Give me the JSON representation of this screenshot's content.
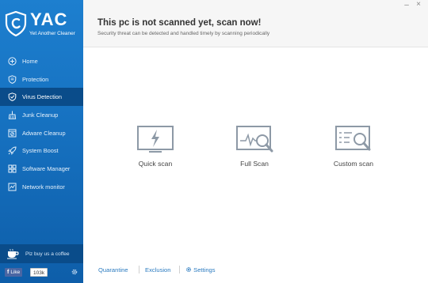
{
  "app": {
    "logo_title": "YAC",
    "logo_subtitle": "Yet Another Cleaner"
  },
  "sidebar": {
    "items": [
      {
        "label": "Home",
        "icon": "home-icon"
      },
      {
        "label": "Protection",
        "icon": "shield-icon"
      },
      {
        "label": "Virus Detection",
        "icon": "shield-check-icon",
        "active": true
      },
      {
        "label": "Junk Cleanup",
        "icon": "broom-icon"
      },
      {
        "label": "Adware Cleanup",
        "icon": "adware-icon"
      },
      {
        "label": "System Boost",
        "icon": "rocket-icon"
      },
      {
        "label": "Software Manager",
        "icon": "grid-icon"
      },
      {
        "label": "Network monitor",
        "icon": "network-icon"
      }
    ],
    "coffee_label": "Plz buy us a coffee",
    "fb_like": "Like",
    "fb_count": "103k"
  },
  "header": {
    "title": "This pc is not scanned yet, scan now!",
    "subtitle": "Security threat can be detected and handled timely by scanning periodically",
    "minimize": "–",
    "close": "×"
  },
  "scan_options": [
    {
      "label": "Quick scan",
      "icon": "lightning-monitor-icon"
    },
    {
      "label": "Full Scan",
      "icon": "pulse-magnifier-icon"
    },
    {
      "label": "Custom scan",
      "icon": "list-magnifier-icon"
    }
  ],
  "footer": {
    "quarantine": "Quarantine",
    "exclusion": "Exclusion",
    "settings": "Settings"
  },
  "colors": {
    "sidebar_top": "#1d7fcf",
    "sidebar_bottom": "#0e5ea9",
    "active_item": "#0a4c8a",
    "link": "#2b7bc0",
    "icon_gray": "#8d99a6"
  }
}
